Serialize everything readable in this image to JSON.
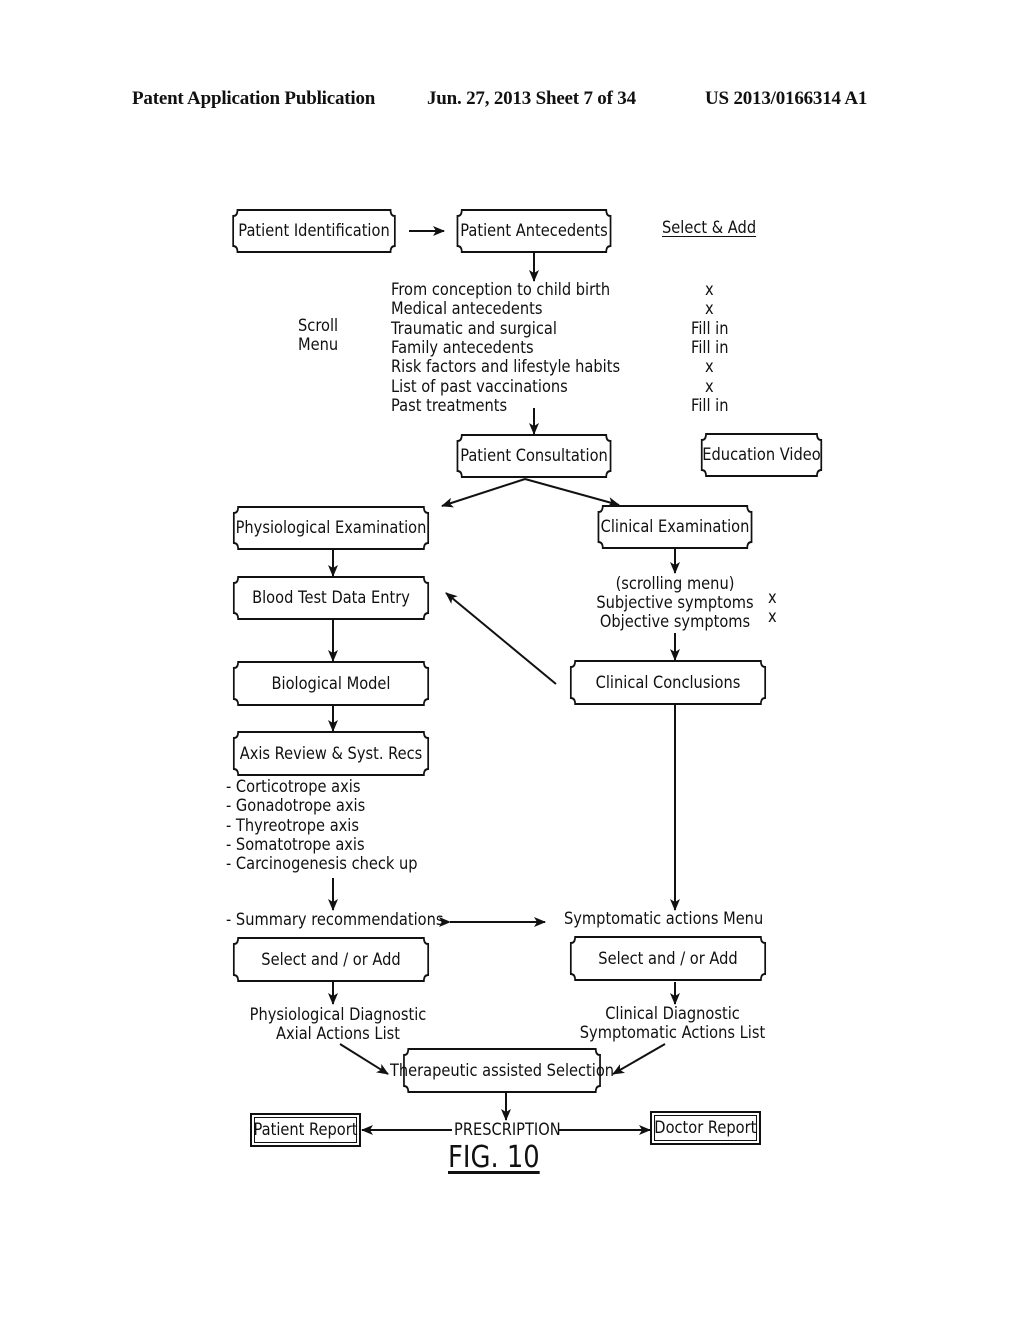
{
  "header": {
    "publication": "Patent Application Publication",
    "date_sheet": "Jun. 27, 2013  Sheet 7 of 34",
    "patent_number": "US 2013/0166314 A1"
  },
  "diagram": {
    "nodes": {
      "patient_identification": "Patient Identification",
      "patient_antecedents": "Patient Antecedents",
      "patient_consultation": "Patient Consultation",
      "education_video": "Education Video",
      "physiological_examination": "Physiological Examination",
      "clinical_examination": "Clinical Examination",
      "blood_test_data_entry": "Blood Test Data Entry",
      "biological_model": "Biological Model",
      "clinical_conclusions": "Clinical Conclusions",
      "axis_review": "Axis Review & Syst. Recs",
      "select_add_left": "Select and / or Add",
      "select_add_right": "Select and / or Add",
      "therapeutic_selection": "Therapeutic assisted Selection",
      "patient_report": "Patient Report",
      "doctor_report": "Doctor Report"
    },
    "select_add_header": "Select & Add",
    "scroll_menu_label": [
      "Scroll",
      "Menu"
    ],
    "antecedents_menu": [
      {
        "item": "From conception to child birth",
        "action": "x"
      },
      {
        "item": "Medical antecedents",
        "action": "x"
      },
      {
        "item": "Traumatic and surgical",
        "action": "Fill in"
      },
      {
        "item": "Family antecedents",
        "action": "Fill in"
      },
      {
        "item": "Risk factors and lifestyle habits",
        "action": "x"
      },
      {
        "item": "List of past vaccinations",
        "action": "x"
      },
      {
        "item": "Past treatments",
        "action": "Fill in"
      }
    ],
    "clinical_menu": {
      "title": "(scrolling menu)",
      "items": [
        {
          "item": "Subjective symptoms",
          "action": "x"
        },
        {
          "item": "Objective symptoms",
          "action": "x"
        }
      ]
    },
    "axis_list": [
      "- Corticotrope axis",
      "- Gonadotrope axis",
      "- Thyreotrope axis",
      "- Somatotrope axis",
      "- Carcinogenesis check up"
    ],
    "summary_recommendations": "- Summary recommendations",
    "symptomatic_actions_menu": "Symptomatic actions Menu",
    "physiological_diagnostic": [
      "Physiological Diagnostic",
      "Axial Actions List"
    ],
    "clinical_diagnostic": [
      "Clinical Diagnostic",
      "Symptomatic Actions List"
    ],
    "prescription": "PRESCRIPTION",
    "figure_label": "FIG. 10"
  }
}
